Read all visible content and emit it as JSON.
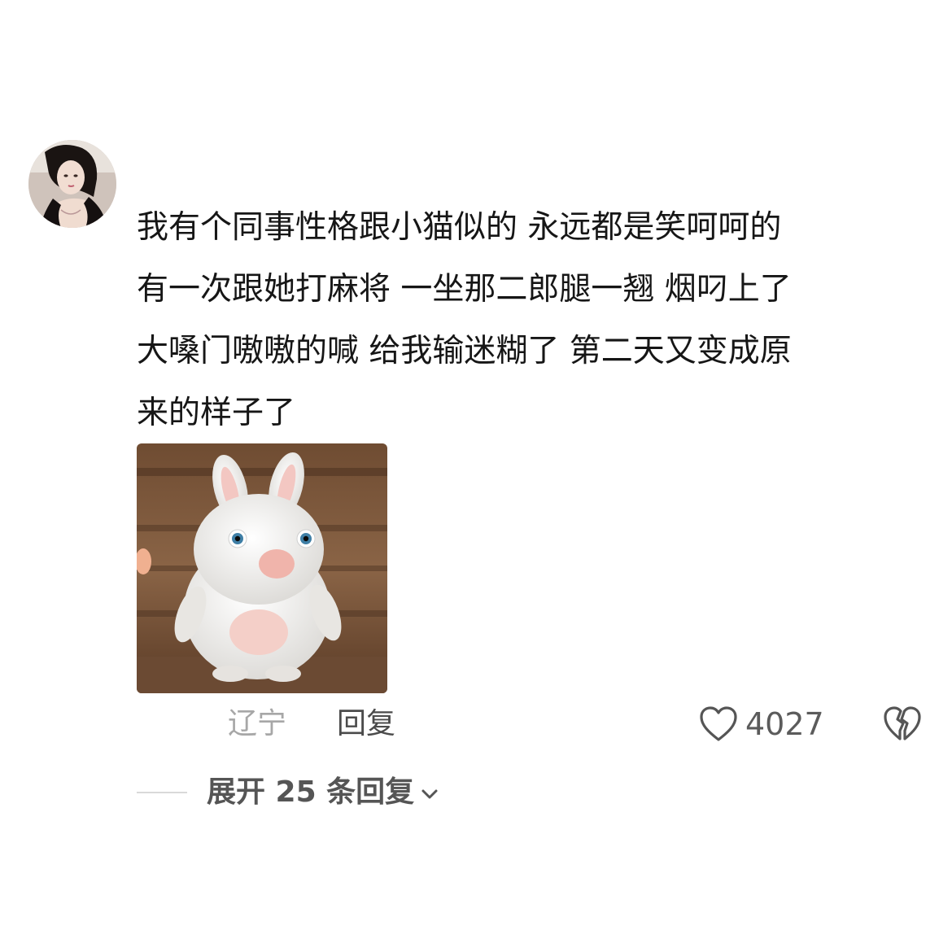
{
  "comment": {
    "avatar_icon": "user-avatar",
    "text_lines": [
      "我有个同事性格跟小猫似的 永远都是笑呵呵的",
      "有一次跟她打麻将 一坐那二郎腿一翘 烟叼上了",
      "大嗓门嗷嗷的喊 给我输迷糊了  第二天又变成原",
      "来的样子了"
    ],
    "sticker_icon": "white-rabbit-sticker",
    "location": "辽宁",
    "reply_label": "回复",
    "like_icon": "heart-outline-icon",
    "like_count": "4027",
    "dislike_icon": "broken-heart-icon",
    "expand_label": "展开 25 条回复",
    "expand_icon": "chevron-down-icon"
  },
  "colors": {
    "text": "#161616",
    "muted": "#a7a7a7",
    "secondary": "#555555"
  }
}
